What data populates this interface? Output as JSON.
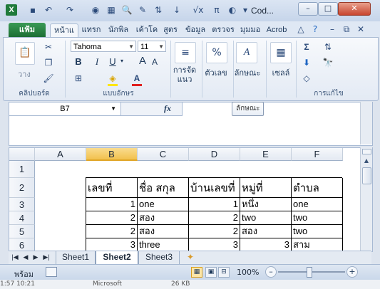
{
  "titlebar": {
    "title": "Cod...",
    "minimize": "–",
    "restore": "□",
    "close": "✕"
  },
  "qat": [
    "save-icon",
    "undo-icon",
    "redo-icon",
    "record-icon",
    "table-icon",
    "preview-icon",
    "paint-icon",
    "sort-icon",
    "formula-icon",
    "pi-icon",
    "chart-icon",
    "more-icon"
  ],
  "tabs": {
    "file": "แฟ้ม",
    "home": "หน้าแ",
    "insert": "แทรก",
    "layout": "นักพิล",
    "formulas": "เค้าโค",
    "data": "สูตร",
    "review": "ข้อมูล",
    "view": "ตรวจร",
    "view2": "มุมมอ",
    "acrobat": "Acrob"
  },
  "ribbon": {
    "clipboard": {
      "paste": "วาง",
      "label": "คลิปบอร์ด"
    },
    "font": {
      "name": "Tahoma",
      "size": "11",
      "bold": "B",
      "italic": "I",
      "underline": "U",
      "grow": "A",
      "shrink": "A",
      "label": "แบบอักษร"
    },
    "alignment": {
      "label": "การจัด\nแนว"
    },
    "number": {
      "icon": "%",
      "label": "ตัวเลข"
    },
    "styles": {
      "label": "ลักษณะ"
    },
    "cells": {
      "label": "เซลล์"
    },
    "editing": {
      "sum": "Σ",
      "label": "การแก้ไข"
    }
  },
  "formula": {
    "namebox": "B7",
    "fx": "fx",
    "content": "",
    "tooltip": "ลักษณะ"
  },
  "columns": [
    "A",
    "B",
    "C",
    "D",
    "E",
    "F"
  ],
  "selected_column": "B",
  "rows": [
    "1",
    "2",
    "3",
    "4",
    "5",
    "6"
  ],
  "table": {
    "header": [
      "เลขที่",
      "ชื่อ   สกุล",
      "บ้านเลขที่",
      "หมู่ที่",
      "ตำบล"
    ],
    "data": [
      [
        "1",
        "one",
        "1",
        "หนึ่ง",
        "one"
      ],
      [
        "2",
        "สอง",
        "2",
        "two",
        "two"
      ],
      [
        "2",
        "สอง",
        "2",
        "สอง",
        "two"
      ],
      [
        "3",
        "three",
        "3",
        "3",
        "สาม"
      ]
    ]
  },
  "sheets": [
    "Sheet1",
    "Sheet2",
    "Sheet3"
  ],
  "active_sheet": "Sheet2",
  "status": {
    "ready": "พร้อม",
    "zoom": "100%",
    "minus": "–",
    "plus": "+"
  },
  "taskbar": {
    "time": "1:57 10:21",
    "app": "Microsoft",
    "size": "26 KB"
  }
}
